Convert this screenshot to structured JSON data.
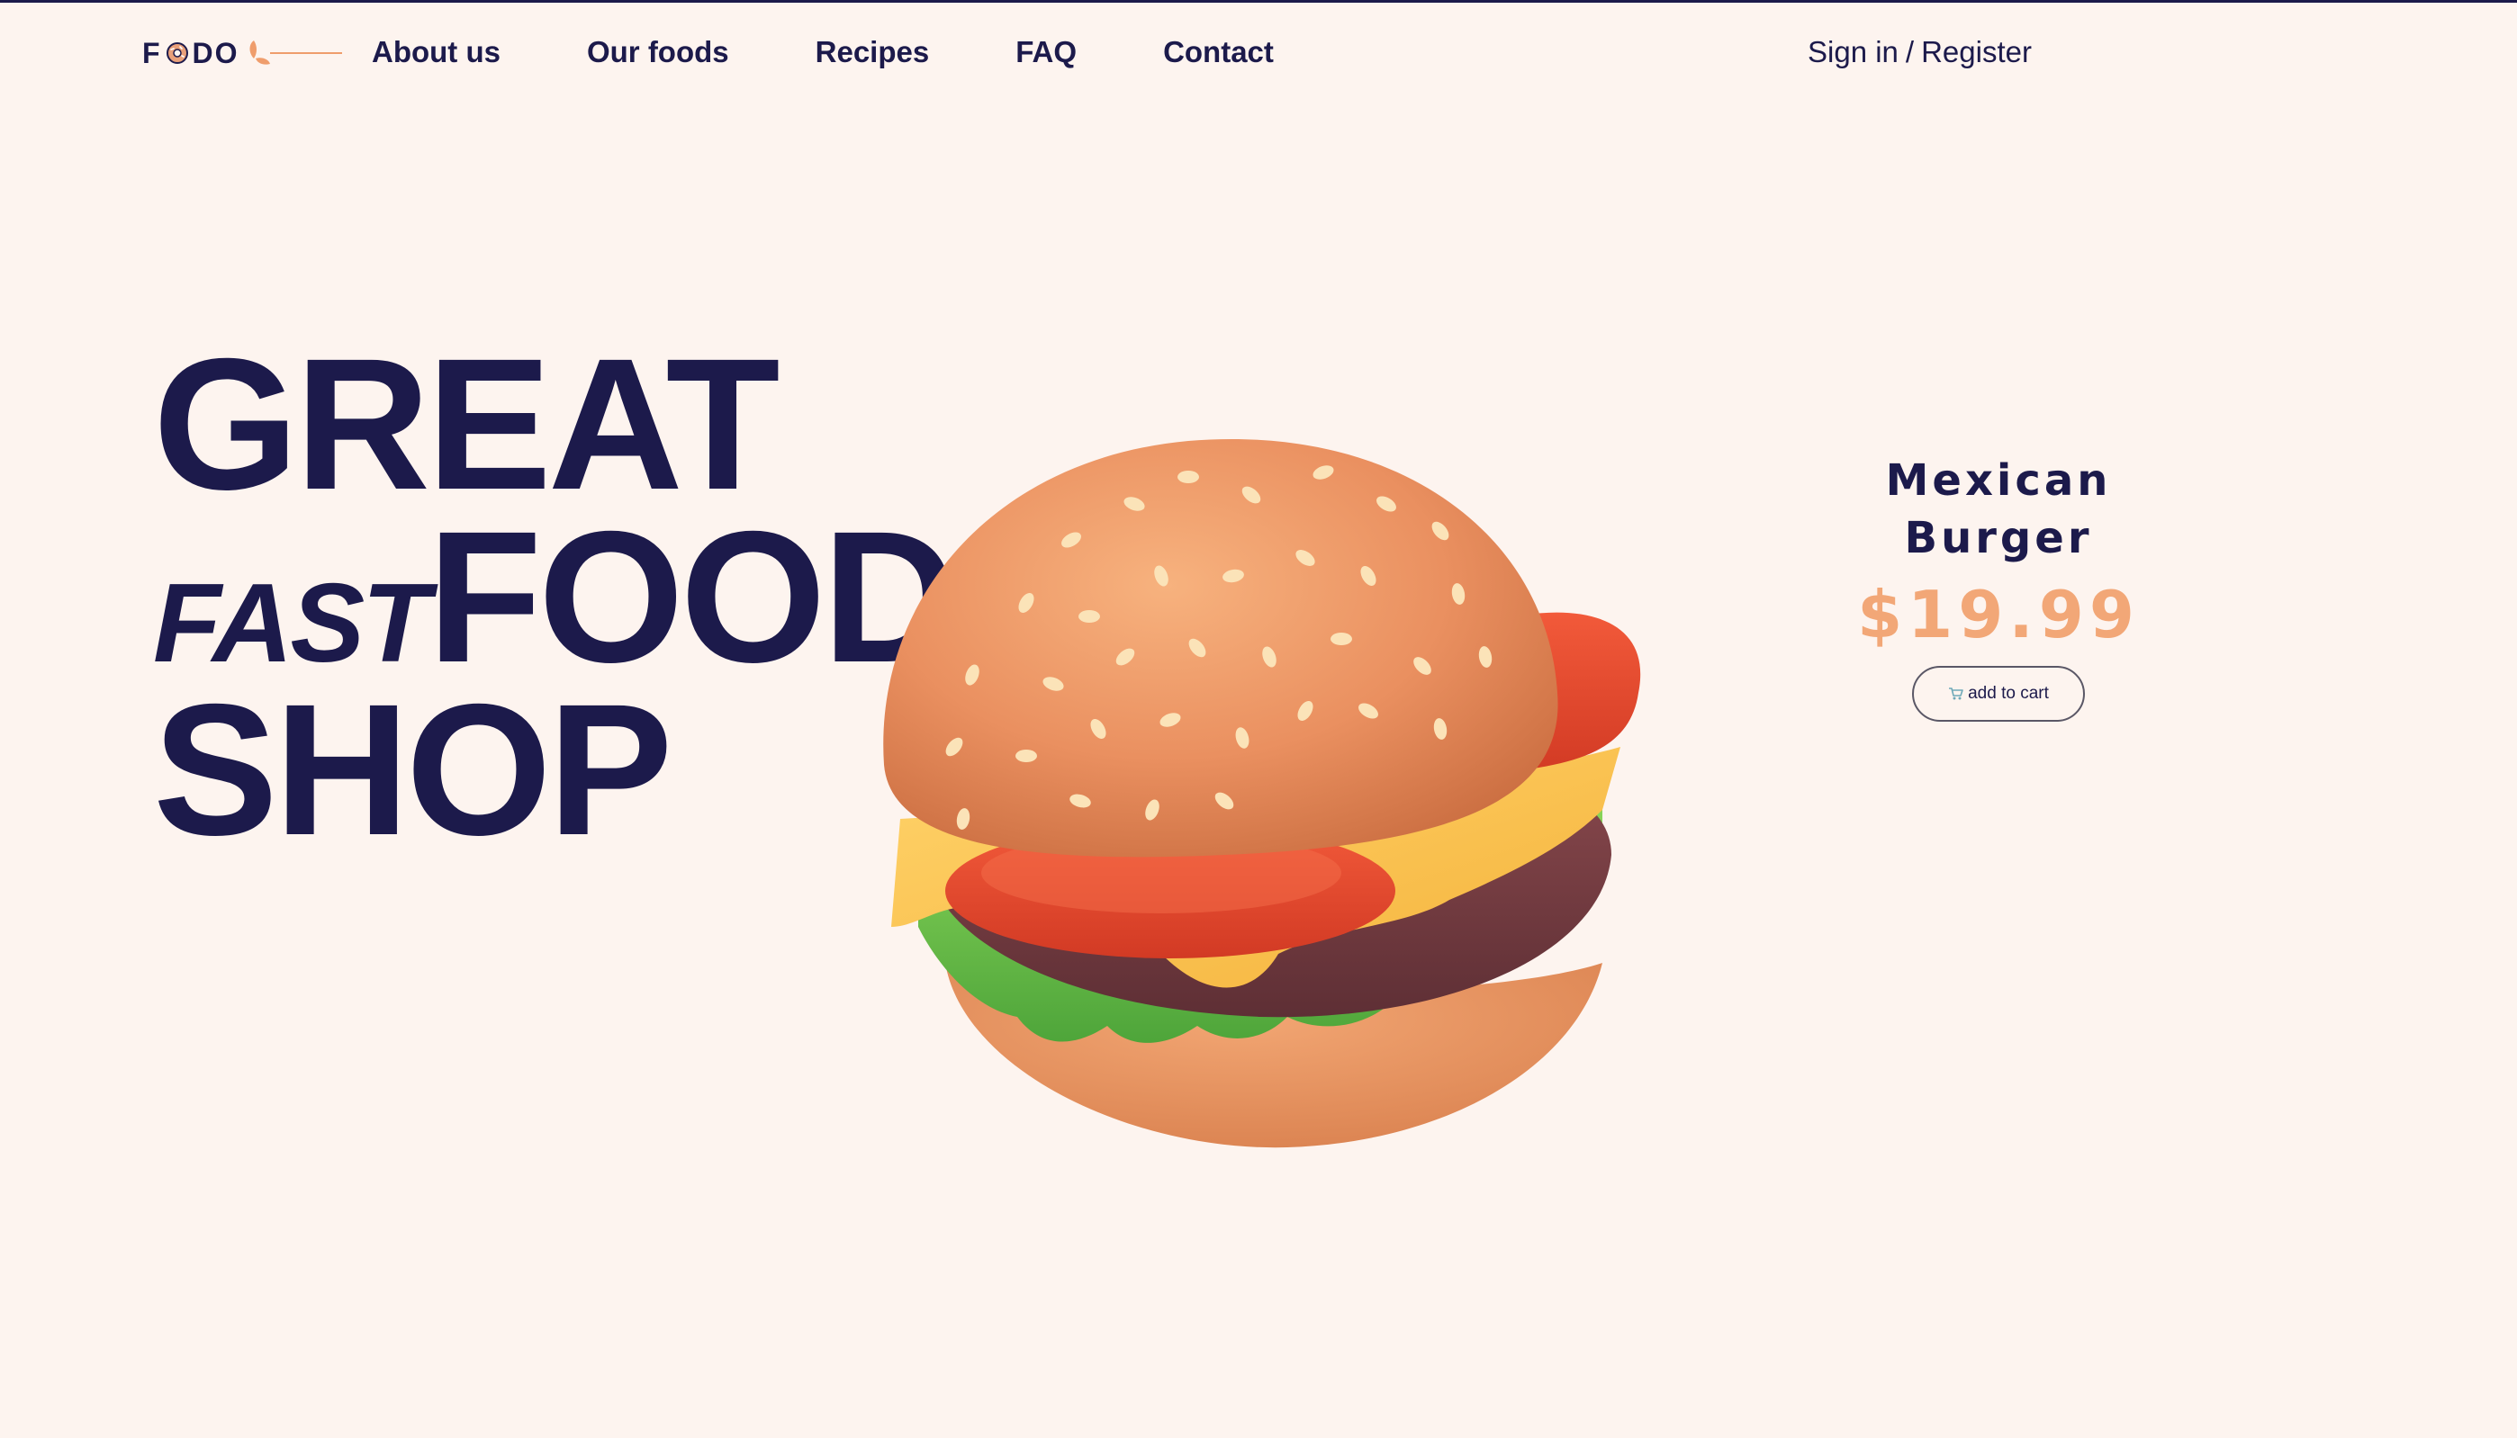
{
  "logo": {
    "text_left": "F",
    "text_right": "DO"
  },
  "nav": {
    "items": [
      {
        "label": "About us"
      },
      {
        "label": "Our foods"
      },
      {
        "label": "Recipes"
      },
      {
        "label": "FAQ"
      },
      {
        "label": "Contact"
      }
    ]
  },
  "auth": {
    "sign_in": "Sign in",
    "separator": "/",
    "register": "Register"
  },
  "hero": {
    "line1": "GREAT",
    "line2_italic": "FAST",
    "line2_bold": "FOOD",
    "line3": "SHOP"
  },
  "product": {
    "name_line1": "Mexican",
    "name_line2": "Burger",
    "price": "$19.99",
    "cart_label": "add to cart",
    "cart_icon": "cart-icon"
  },
  "colors": {
    "background": "#fdf4ef",
    "navy": "#1c1a4b",
    "accent": "#f2a777"
  }
}
